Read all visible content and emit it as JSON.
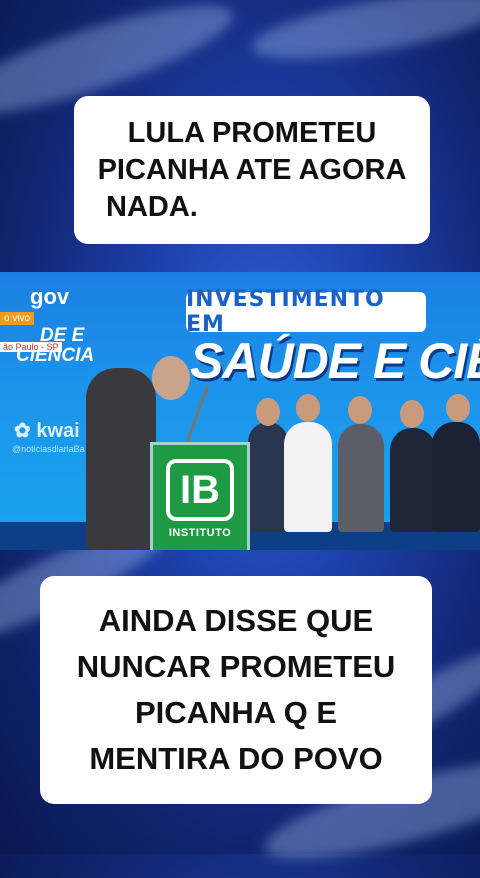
{
  "top_caption": {
    "lines": [
      "LULA PROMETEU",
      "PICANHA ATE AGORA",
      "NADA."
    ]
  },
  "bottom_caption": {
    "lines": [
      "AINDA DISSE QUE",
      "NUNCAR PROMETEU",
      "PICANHA Q E",
      "MENTIRA DO POVO"
    ]
  },
  "video": {
    "banner_title": "INVESTIMENTO EM",
    "big_title": "SAÚDE E CIÊN",
    "gov_label": "gov",
    "live_tag": "o vivo",
    "logo_text_1": "DE E",
    "logo_text_2": "CIÊNCIA",
    "location_tag": "ão Paulo - SP",
    "watermark": "kwai",
    "watermark_user": "@noticiasdiariaBa",
    "podium_logo": "IB",
    "podium_label": "INSTITUTO"
  },
  "colors": {
    "background": "#1c3fa8",
    "caption_bg": "#ffffff",
    "caption_text": "#111111",
    "banner_blue": "#1d93ec",
    "podium_green": "#1e9a45"
  }
}
